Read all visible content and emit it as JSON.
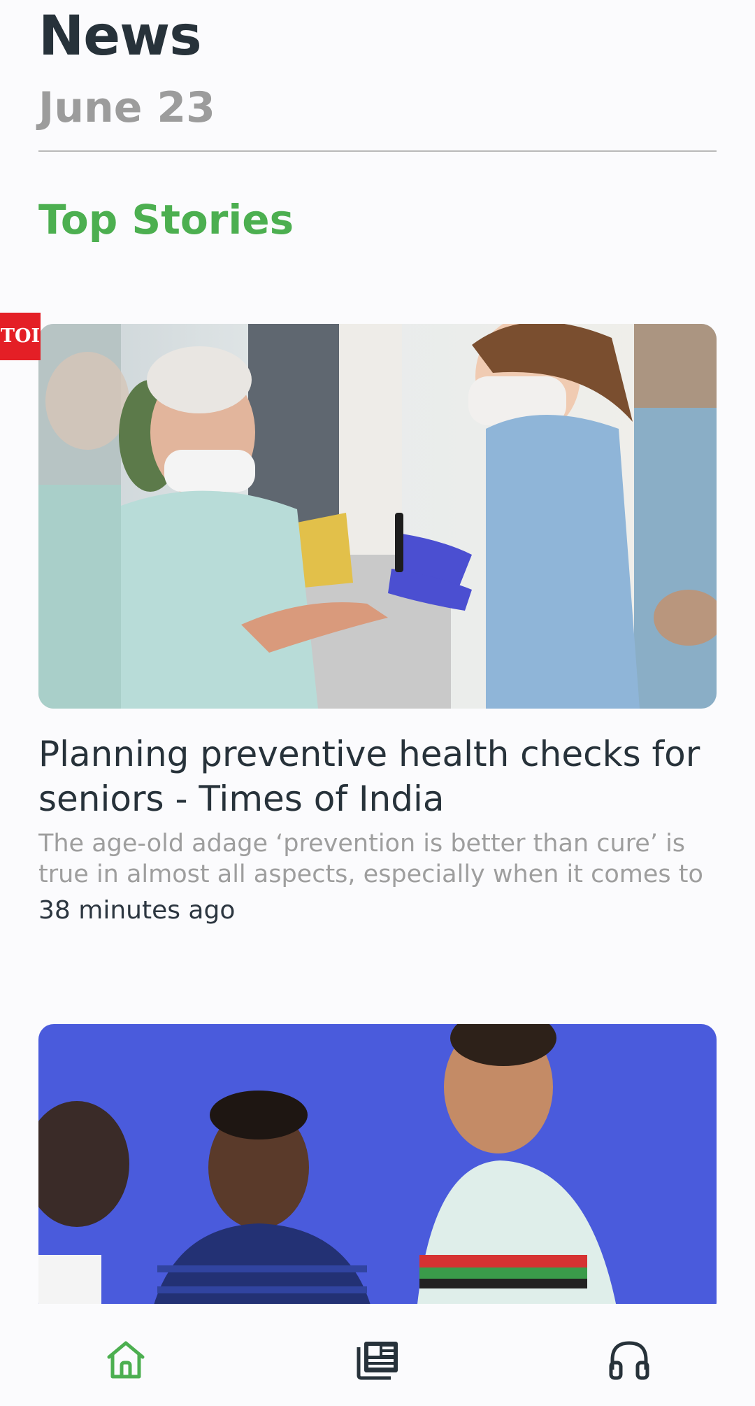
{
  "header": {
    "title": "News",
    "date": "June 23"
  },
  "section": {
    "title": "Top Stories"
  },
  "articles": [
    {
      "headline": "Planning preventive health checks for seniors - Times of India",
      "snippet": "The age-old adage ‘prevention is better than cure’ is true in almost all aspects, especially when it comes to",
      "time": "38 minutes ago",
      "source_badge": "TOI"
    }
  ],
  "bottom_nav": {
    "items": [
      {
        "icon": "home-icon",
        "active": true
      },
      {
        "icon": "newspaper-icon",
        "active": false
      },
      {
        "icon": "headphones-icon",
        "active": false
      }
    ]
  },
  "colors": {
    "accent": "#4caf50",
    "title": "#27323a",
    "muted": "#9c9c9c",
    "background": "#fbfbfd",
    "badge": "#e41f26"
  }
}
